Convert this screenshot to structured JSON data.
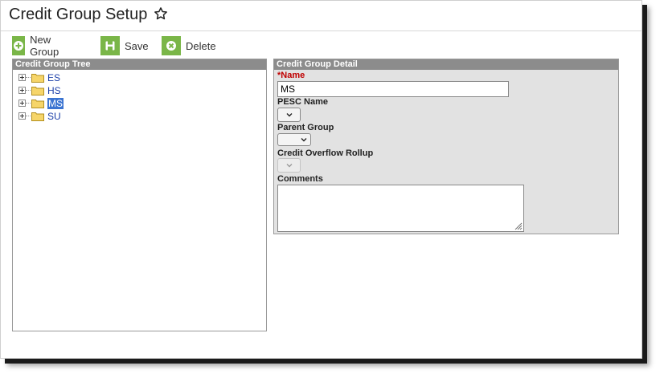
{
  "page": {
    "title": "Credit Group Setup",
    "favorite_icon": "star-outline-icon"
  },
  "toolbar": {
    "new_group_label": "New Group",
    "save_label": "Save",
    "delete_label": "Delete",
    "icon_color": "#7ab648"
  },
  "tree": {
    "header": "Credit Group Tree",
    "items": [
      {
        "label": "ES",
        "selected": false
      },
      {
        "label": "HS",
        "selected": false
      },
      {
        "label": "MS",
        "selected": true
      },
      {
        "label": "SU",
        "selected": false
      }
    ]
  },
  "detail": {
    "header": "Credit Group Detail",
    "name_label": "*Name",
    "name_value": "MS",
    "pesc_label": "PESC Name",
    "pesc_value": "",
    "parent_label": "Parent Group",
    "parent_value": "",
    "overflow_label": "Credit Overflow Rollup",
    "overflow_value": "",
    "comments_label": "Comments",
    "comments_value": ""
  },
  "colors": {
    "panel_header": "#8c8c8c",
    "required": "#c00000",
    "selection": "#3b74d1",
    "link": "#1a3ea8"
  }
}
